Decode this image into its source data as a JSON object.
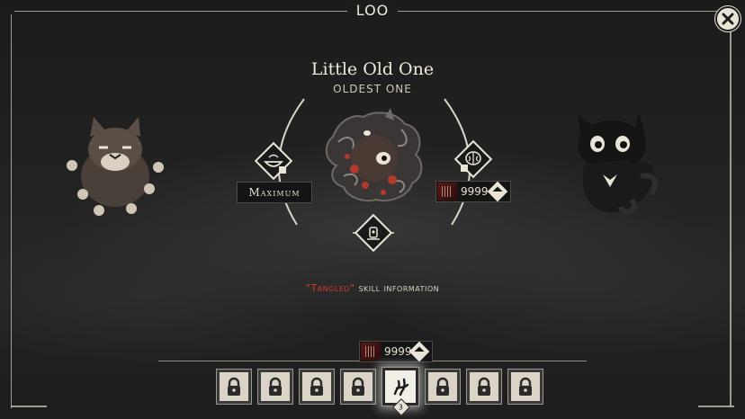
{
  "window": {
    "title": "LOO",
    "close_icon": "close-icon"
  },
  "character": {
    "name": "Little Old One",
    "subtitle": "OLDEST ONE"
  },
  "left_tag": {
    "label": "Maximum",
    "icon": "bowl-icon"
  },
  "right_tag": {
    "value": "9999",
    "icon": "brain-icon",
    "upgrade_icon": "upgrade-icon"
  },
  "skill": {
    "name": "\"Tangled\"",
    "suffix": " skill information",
    "accent_color": "#d23a2a"
  },
  "bottom_bar": {
    "value": "9999"
  },
  "slots": [
    {
      "id": "slot-1",
      "state": "locked"
    },
    {
      "id": "slot-2",
      "state": "locked"
    },
    {
      "id": "slot-3",
      "state": "locked"
    },
    {
      "id": "slot-4",
      "state": "locked"
    },
    {
      "id": "slot-5",
      "state": "active",
      "badge": "3"
    },
    {
      "id": "slot-6",
      "state": "locked"
    },
    {
      "id": "slot-7",
      "state": "locked"
    },
    {
      "id": "slot-8",
      "state": "locked"
    }
  ]
}
